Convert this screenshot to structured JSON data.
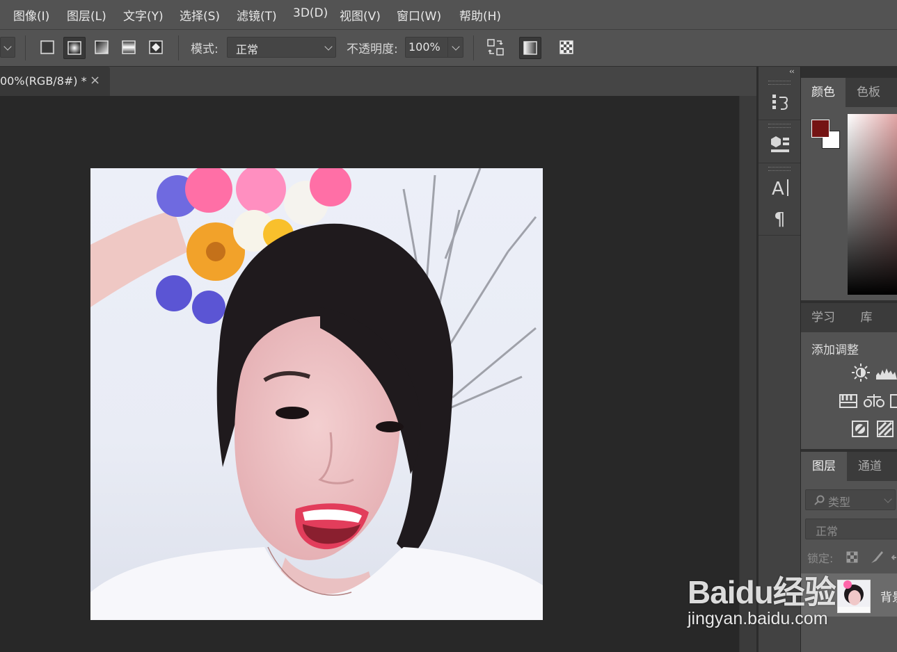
{
  "menu": [
    "图像(I)",
    "图层(L)",
    "文字(Y)",
    "选择(S)",
    "滤镜(T)",
    "3D(D)",
    "视图(V)",
    "窗口(W)",
    "帮助(H)"
  ],
  "options": {
    "mode_label": "模式:",
    "mode_value": "正常",
    "opacity_label": "不透明度:",
    "opacity_value": "100%"
  },
  "document": {
    "tab_title": "00%(RGB/8#) *",
    "close_glyph": "×"
  },
  "dock": {
    "collapse_glyph": "‹‹"
  },
  "color_panel": {
    "tabs": [
      "颜色",
      "色板"
    ],
    "foreground": "#741414",
    "background": "#ffffff"
  },
  "adjust_panel": {
    "tabs": [
      "学习",
      "库"
    ],
    "title": "添加调整"
  },
  "layers_panel": {
    "tabs": [
      "图层",
      "通道"
    ],
    "filter_placeholder": "类型",
    "blend_mode": "正常",
    "lock_label": "锁定:",
    "layer_name": "背景"
  },
  "watermark": {
    "main": "Baidu经验",
    "sub": "jingyan.baidu.com"
  }
}
